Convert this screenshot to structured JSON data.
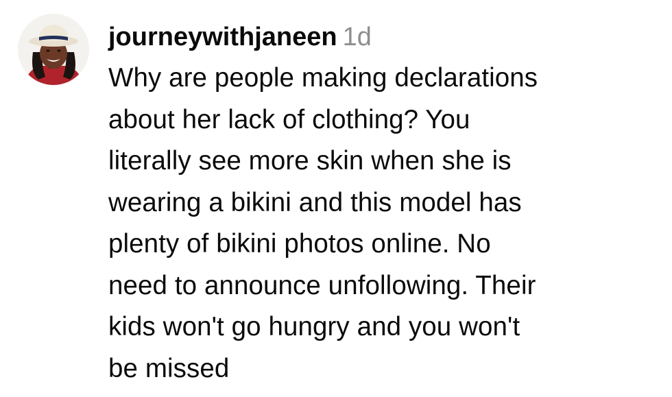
{
  "comment": {
    "avatar_icon": "user-avatar-photo",
    "username": "journeywithjaneen",
    "timestamp": "1d",
    "text": "Why are people making declarations\nabout her lack of clothing? You\nliterally see more skin when she is\nwearing a bikini and this model has\nplenty of bikini photos online. No\nneed to announce unfollowing. Their\nkids won't go hungry and you won't\nbe missed"
  },
  "colors": {
    "text": "#0a0a0a",
    "timestamp": "#8e8e8e",
    "background": "#ffffff"
  }
}
